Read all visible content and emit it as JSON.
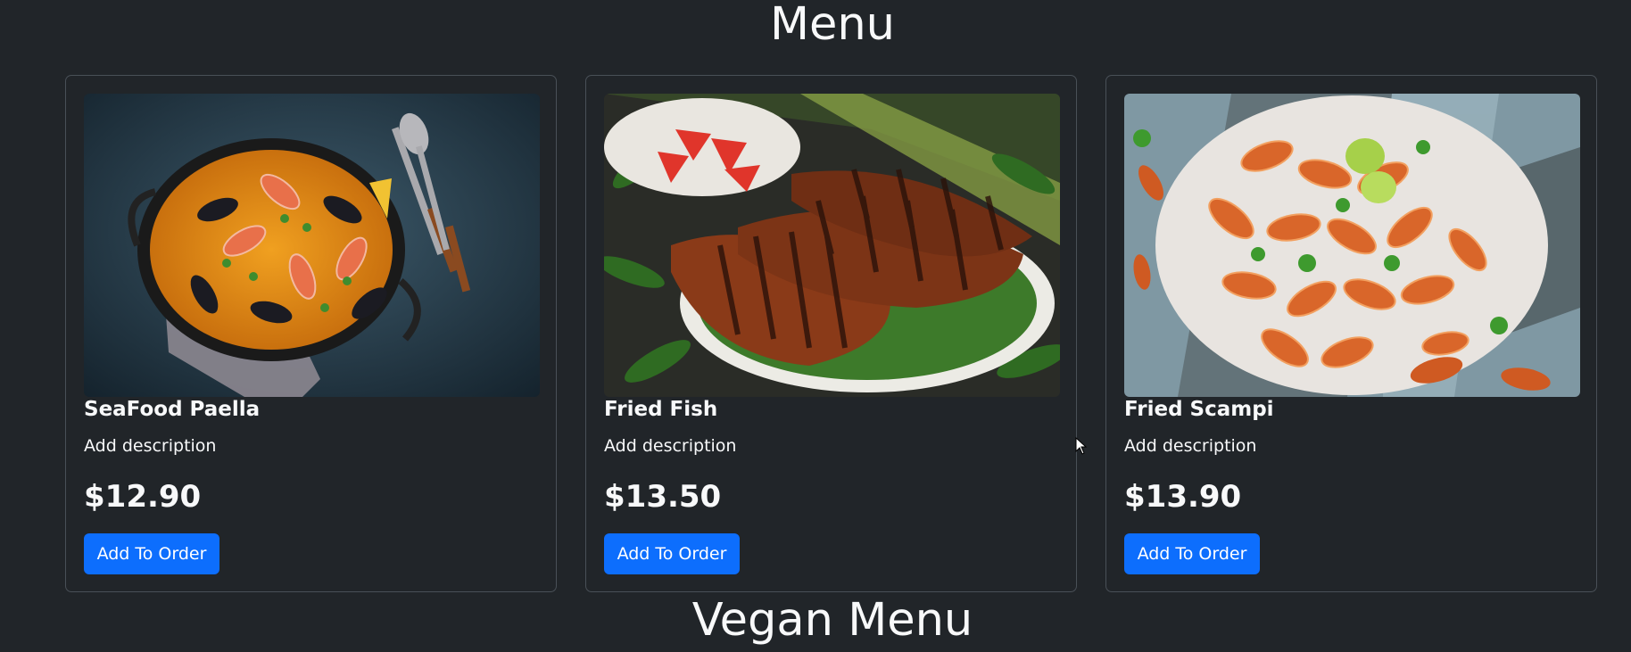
{
  "menu": {
    "title": "Menu",
    "items": [
      {
        "name": "SeaFood Paella",
        "description": "Add description",
        "price": "$12.90",
        "button_label": "Add To Order",
        "image": "seafood-paella-image"
      },
      {
        "name": "Fried Fish",
        "description": "Add description",
        "price": "$13.50",
        "button_label": "Add To Order",
        "image": "fried-fish-image"
      },
      {
        "name": "Fried Scampi",
        "description": "Add description",
        "price": "$13.90",
        "button_label": "Add To Order",
        "image": "fried-scampi-image"
      }
    ]
  },
  "vegan_menu": {
    "title": "Vegan Menu"
  },
  "colors": {
    "background": "#212529",
    "card_border": "#495057",
    "button": "#0d6efd",
    "text": "#f8f9fa"
  }
}
